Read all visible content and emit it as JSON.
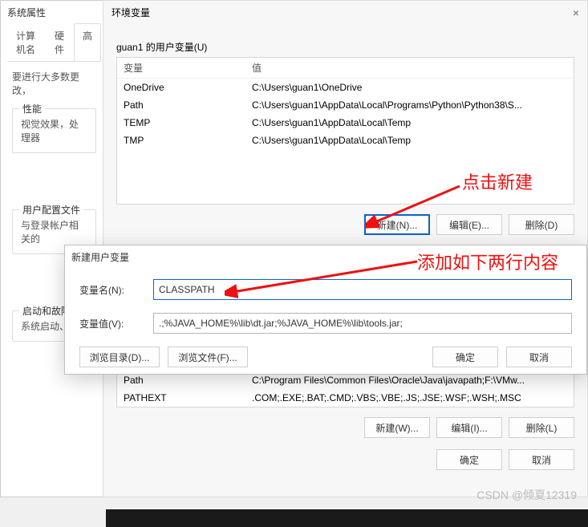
{
  "sysprops": {
    "title": "系统属性",
    "tabs": {
      "t1": "计算机名",
      "t2": "硬件",
      "t3": "高"
    },
    "note": "要进行大多数更改，",
    "group_perf": "性能",
    "perf_desc": "视觉效果，处理器",
    "group_profile": "用户配置文件",
    "profile_desc": "与登录帐户相关的",
    "group_startup": "启动和故障",
    "startup_desc": "系统启动、"
  },
  "env": {
    "title": "环境变量",
    "user_section": "guan1 的用户变量(U)",
    "thead_var": "变量",
    "thead_val": "值",
    "user_rows": [
      {
        "v": "OneDrive",
        "d": "C:\\Users\\guan1\\OneDrive"
      },
      {
        "v": "Path",
        "d": "C:\\Users\\guan1\\AppData\\Local\\Programs\\Python\\Python38\\S..."
      },
      {
        "v": "TEMP",
        "d": "C:\\Users\\guan1\\AppData\\Local\\Temp"
      },
      {
        "v": "TMP",
        "d": "C:\\Users\\guan1\\AppData\\Local\\Temp"
      }
    ],
    "btn_new_n": "新建(N)...",
    "btn_edit_e": "编辑(E)...",
    "btn_del_d": "删除(D)",
    "sys_rows": [
      {
        "v": "Path",
        "d": "C:\\Program Files\\Common Files\\Oracle\\Java\\javapath;F:\\VMw..."
      },
      {
        "v": "PATHEXT",
        "d": ".COM;.EXE;.BAT;.CMD;.VBS;.VBE;.JS;.JSE;.WSF;.WSH;.MSC"
      }
    ],
    "btn_new_w": "新建(W)...",
    "btn_edit_i": "编辑(I)...",
    "btn_del_l": "删除(L)",
    "btn_ok": "确定",
    "btn_cancel": "取消"
  },
  "dlg": {
    "title": "新建用户变量",
    "lbl_name": "变量名(N):",
    "lbl_value": "变量值(V):",
    "val_name": "CLASSPATH",
    "val_value": ".;%JAVA_HOME%\\lib\\dt.jar;%JAVA_HOME%\\lib\\tools.jar;",
    "btn_browse_dir": "浏览目录(D)...",
    "btn_browse_file": "浏览文件(F)...",
    "btn_ok": "确定",
    "btn_cancel": "取消"
  },
  "annot": {
    "a1": "点击新建",
    "a2": "添加如下两行内容"
  },
  "watermark": "CSDN @倾夏12319"
}
